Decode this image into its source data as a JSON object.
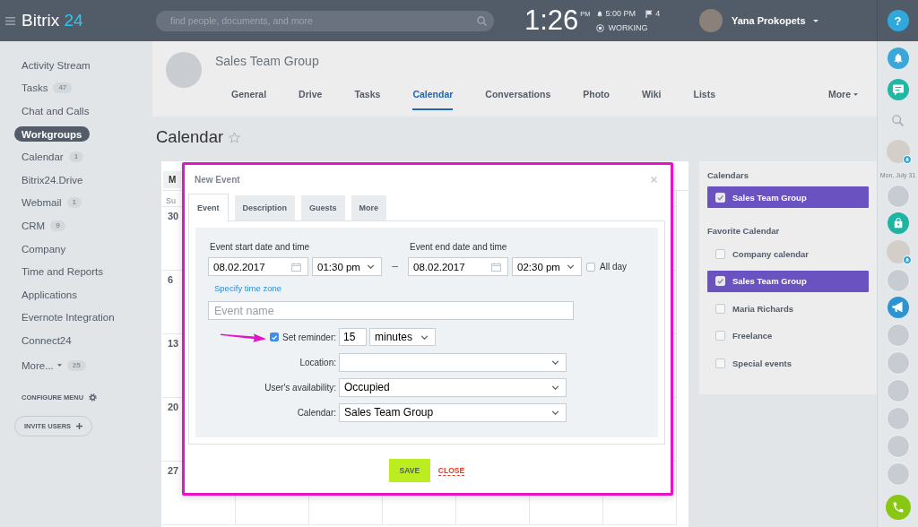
{
  "header": {
    "logo": {
      "name": "Bitrix",
      "number": "24"
    },
    "search": {
      "placeholder": "find people, documents, and more"
    },
    "clock": {
      "time": "1:26",
      "period": "PM"
    },
    "alarm": "5:00 PM",
    "flags": "4",
    "work_status": "WORKING",
    "user": {
      "name": "Yana Prokopets"
    },
    "help": "?"
  },
  "sidebar": {
    "items": [
      {
        "label": "Activity Stream",
        "selected": false,
        "dropdown": false
      },
      {
        "label": "Tasks",
        "count": "47",
        "selected": false,
        "dropdown": false
      },
      {
        "label": "Chat and Calls",
        "selected": false,
        "dropdown": false
      },
      {
        "label": "Workgroups",
        "selected": true,
        "dropdown": false
      },
      {
        "label": "Calendar",
        "count": "1",
        "selected": false,
        "dropdown": false
      },
      {
        "label": "Bitrix24.Drive",
        "selected": false,
        "dropdown": false
      },
      {
        "label": "Webmail",
        "count": "1",
        "selected": false,
        "dropdown": false
      },
      {
        "label": "CRM",
        "count": "9",
        "selected": false,
        "dropdown": false
      },
      {
        "label": "Company",
        "selected": false,
        "dropdown": false
      },
      {
        "label": "Time and Reports",
        "selected": false,
        "dropdown": false
      },
      {
        "label": "Applications",
        "selected": false,
        "dropdown": false
      },
      {
        "label": "Evernote Integration",
        "selected": false,
        "dropdown": false
      },
      {
        "label": "Connect24",
        "selected": false,
        "dropdown": false
      },
      {
        "label": "More...",
        "count": "25",
        "selected": false,
        "dropdown": true
      }
    ],
    "configure": "CONFIGURE MENU",
    "invite": "INVITE USERS"
  },
  "group": {
    "name": "Sales Team Group",
    "tabs": [
      {
        "label": "General",
        "selected": false,
        "dropdown": false
      },
      {
        "label": "Drive",
        "selected": false,
        "dropdown": false
      },
      {
        "label": "Tasks",
        "selected": false,
        "dropdown": false
      },
      {
        "label": "Calendar",
        "selected": true,
        "dropdown": false
      },
      {
        "label": "Conversations",
        "selected": false,
        "dropdown": false
      },
      {
        "label": "Photo",
        "selected": false,
        "dropdown": false
      },
      {
        "label": "Wiki",
        "selected": false,
        "dropdown": false
      },
      {
        "label": "Lists",
        "selected": false,
        "dropdown": false
      },
      {
        "label": "More",
        "selected": false,
        "dropdown": true
      }
    ]
  },
  "page": {
    "title": "Calendar",
    "favorite": false
  },
  "calendar": {
    "view": "M",
    "weekday": "Su",
    "week_days": [
      "30",
      "6",
      "13",
      "20",
      "27"
    ]
  },
  "dialog": {
    "title": "New Event",
    "tabs": [
      {
        "label": "Event",
        "selected": true
      },
      {
        "label": "Description",
        "selected": false
      },
      {
        "label": "Guests",
        "selected": false
      },
      {
        "label": "More",
        "selected": false
      }
    ],
    "start": {
      "label": "Event start date and time",
      "date": "08.02.2017",
      "time": "01:30 pm"
    },
    "separator": "–",
    "end": {
      "label": "Event end date and time",
      "date": "08.02.2017",
      "time": "02:30 pm"
    },
    "all_day": {
      "label": "All day",
      "checked": false
    },
    "timezone_link": "Specify time zone",
    "event_name": {
      "placeholder": "Event name"
    },
    "reminder": {
      "label": "Set reminder:",
      "checked": true,
      "amount": "15",
      "unit": "minutes"
    },
    "fields": [
      {
        "label": "Location:"
      },
      {
        "label": "User's availability:",
        "value": "Occupied"
      },
      {
        "label": "Calendar:",
        "value": "Sales Team Group"
      }
    ],
    "buttons": {
      "save": "SAVE",
      "close": "CLOSE"
    }
  },
  "calendar_list": {
    "sections": [
      {
        "title": "Calendars",
        "items": [
          {
            "label": "Sales Team Group",
            "checked": true
          }
        ]
      },
      {
        "title": "Favorite Calendar",
        "items": [
          {
            "label": "Company calendar",
            "checked": false
          },
          {
            "label": "Sales Team Group",
            "checked": true
          },
          {
            "label": "Maria Richards",
            "checked": false
          },
          {
            "label": "Freelance",
            "checked": false
          },
          {
            "label": "Special events",
            "checked": false
          }
        ]
      }
    ]
  },
  "right_bar": {
    "date": "Mon, July 31"
  }
}
